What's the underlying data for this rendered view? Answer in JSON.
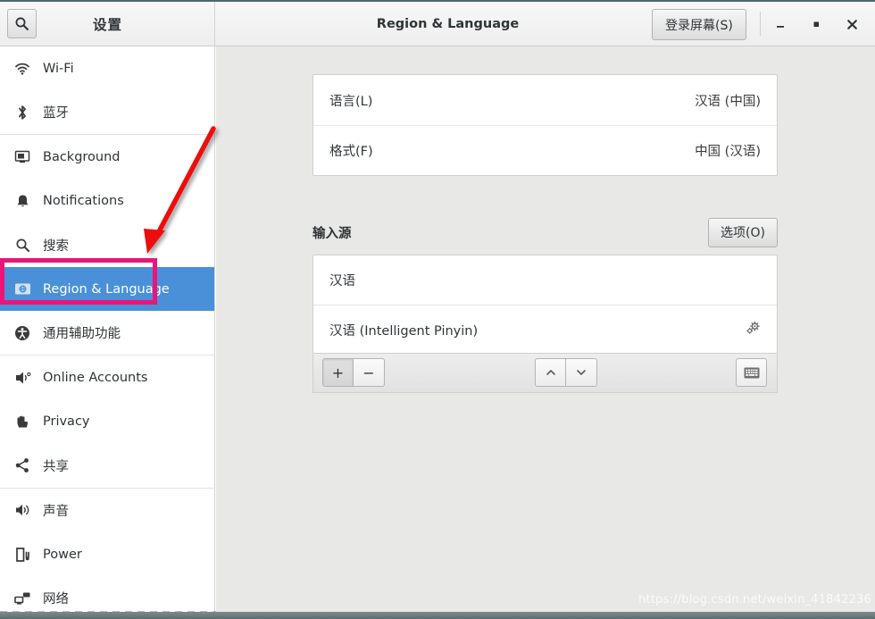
{
  "window": {
    "app_title": "设置",
    "page_title": "Region & Language",
    "login_screen_button": "登录屏幕(S)",
    "search_icon": "search-icon",
    "minimize_label": "—",
    "maximize_label": "◻",
    "close_label": "✕"
  },
  "sidebar": {
    "items": [
      {
        "label": "Wi-Fi",
        "icon": "wifi-icon",
        "selected": false
      },
      {
        "label": "蓝牙",
        "icon": "bluetooth-icon",
        "selected": false
      },
      {
        "label": "Background",
        "icon": "background-monitor-icon",
        "selected": false
      },
      {
        "label": "Notifications",
        "icon": "bell-icon",
        "selected": false
      },
      {
        "label": "搜索",
        "icon": "search-icon",
        "selected": false
      },
      {
        "label": "Region & Language",
        "icon": "region-language-icon",
        "selected": true
      },
      {
        "label": "通用辅助功能",
        "icon": "accessibility-icon",
        "selected": false
      },
      {
        "label": "Online Accounts",
        "icon": "online-accounts-icon",
        "selected": false
      },
      {
        "label": "Privacy",
        "icon": "privacy-hand-icon",
        "selected": false
      },
      {
        "label": "共享",
        "icon": "sharing-icon",
        "selected": false
      },
      {
        "label": "声音",
        "icon": "sound-speaker-icon",
        "selected": false
      },
      {
        "label": "Power",
        "icon": "power-battery-icon",
        "selected": false
      },
      {
        "label": "网络",
        "icon": "network-icon",
        "selected": false
      }
    ]
  },
  "content": {
    "language_rows": [
      {
        "label": "语言(L)",
        "value": "汉语 (中国)"
      },
      {
        "label": "格式(F)",
        "value": "中国 (汉语)"
      }
    ],
    "input_sources": {
      "section_title": "输入源",
      "options_button": "选项(O)",
      "rows": [
        {
          "label": "汉语",
          "has_gear": false
        },
        {
          "label": "汉语 (Intelligent Pinyin)",
          "has_gear": true
        }
      ],
      "toolbar": {
        "add_label": "+",
        "remove_label": "−",
        "move_up_label": "⌃",
        "move_down_label": "⌄",
        "keyboard_icon": "keyboard-icon"
      }
    }
  },
  "annotations": {
    "highlight_color": "#ec1478",
    "arrow_color": "#ee1111",
    "selection_color": "#4a90d9",
    "watermark": "https://blog.csdn.net/weixin_41842236"
  }
}
